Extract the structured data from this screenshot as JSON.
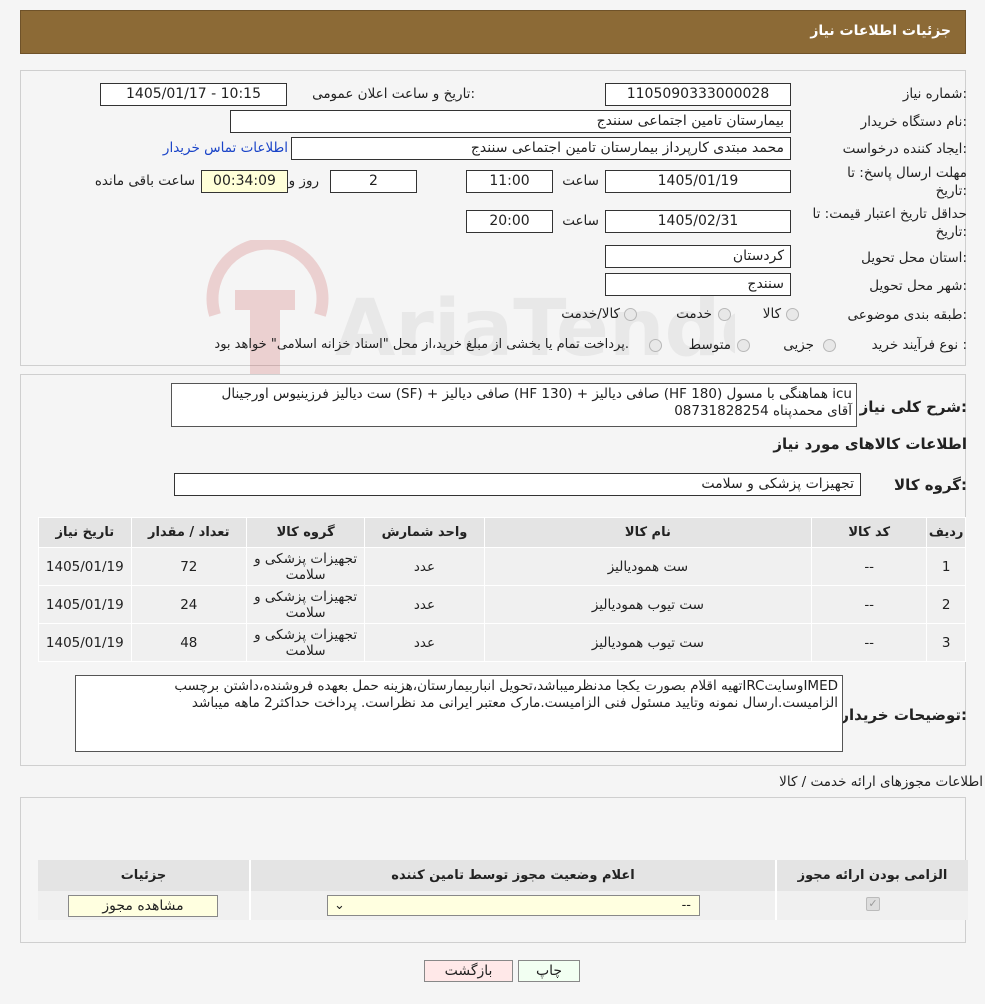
{
  "header": {
    "title": "جزئیات اطلاعات نیاز"
  },
  "form": {
    "need_number_label": "شماره نیاز:",
    "need_number": "1105090333000028",
    "announce_label": "تاریخ و ساعت اعلان عمومی:",
    "announce_value": "1405/01/17 - 10:15",
    "buyer_org_label": "نام دستگاه خریدار:",
    "buyer_org": "بیمارستان تامین اجتماعی سنندج",
    "creator_label": "ایجاد کننده درخواست:",
    "creator": "محمد مبتدی کارپرداز بیمارستان تامین اجتماعی سنندج",
    "contact_link": "اطلاعات تماس خریدار",
    "reply_deadline_label_1": "مهلت ارسال پاسخ: تا",
    "reply_deadline_label_2": "تاریخ:",
    "reply_date": "1405/01/19",
    "time_label": "ساعت",
    "reply_time": "11:00",
    "days_value": "2",
    "days_label": "روز و",
    "remaining_time": "00:34:09",
    "remaining_label": "ساعت باقی مانده",
    "price_validity_label_1": "حداقل تاریخ اعتبار قیمت: تا",
    "price_validity_label_2": "تاریخ:",
    "price_date": "1405/02/31",
    "price_time": "20:00",
    "province_label": "استان محل تحویل:",
    "province": "کردستان",
    "city_label": "شهر محل تحویل:",
    "city": "سنندج",
    "category_label": "طبقه بندی موضوعی:",
    "category_options": [
      "کالا",
      "خدمت",
      "کالا/خدمت"
    ],
    "process_label": "نوع فرآیند خرید :",
    "process_options": [
      "جزیی",
      "متوسط"
    ],
    "process_note": "پرداخت تمام یا بخشی از مبلغ خرید،از محل \"اسناد خزانه اسلامی\" خواهد بود."
  },
  "summary": {
    "label": "شرح کلی نیاز:",
    "text_line1": "ست دیالیز فرزینیوس اورجینال (SF) + صافی دیالیز (HF 130) + صافی دیالیز (HF 180) هماهنگی با مسول icu",
    "text_line2": "آقای محمدپناه 08731828254"
  },
  "goods": {
    "section_title": "اطلاعات کالاهای مورد نیاز",
    "group_label": "گروه کالا:",
    "group_value": "تجهیزات پزشکی و سلامت",
    "columns": [
      "ردیف",
      "کد کالا",
      "نام کالا",
      "واحد شمارش",
      "گروه کالا",
      "تعداد / مقدار",
      "تاریخ نیاز"
    ],
    "rows": [
      {
        "row": "1",
        "code": "--",
        "name": "ست همودیالیز",
        "unit": "عدد",
        "group": "تجهیزات پزشکی و سلامت",
        "qty": "72",
        "date": "1405/01/19"
      },
      {
        "row": "2",
        "code": "--",
        "name": "ست تیوب همودیالیز",
        "unit": "عدد",
        "group": "تجهیزات پزشکی و سلامت",
        "qty": "24",
        "date": "1405/01/19"
      },
      {
        "row": "3",
        "code": "--",
        "name": "ست تیوب همودیالیز",
        "unit": "عدد",
        "group": "تجهیزات پزشکی و سلامت",
        "qty": "48",
        "date": "1405/01/19"
      }
    ]
  },
  "buyer_notes": {
    "label": "توضیحات خریدار:",
    "line1": "تهیه اقلام بصورت یکجا مدنظرمیباشد،تحویل انباربیمارستان،هزینه حمل بعهده فروشنده،داشتن برچسبIRCوسایتIMED",
    "line2": "الزامیست.ارسال نمونه وتایید مسئول فنی الزامیست.مارک معتبر ایرانی مد نظراست. پرداخت حداکثر2 ماهه میباشد"
  },
  "permits": {
    "section_title": "اطلاعات مجوزهای ارائه خدمت / کالا",
    "columns": [
      "الزامی بودن ارائه مجوز",
      "اعلام وضعیت مجوز توسط تامین کننده",
      "جزئیات"
    ],
    "select_value": "--",
    "view_button": "مشاهده مجوز"
  },
  "footer": {
    "print_button": "چاپ",
    "back_button": "بازگشت"
  },
  "watermark_text": "AriaTender.neT"
}
